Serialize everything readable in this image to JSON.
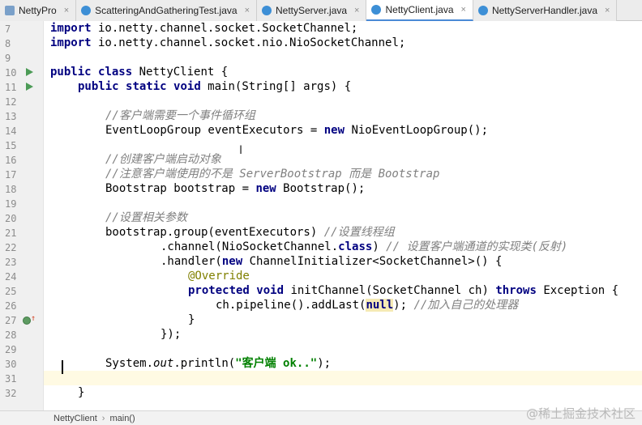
{
  "tabs": [
    {
      "label": "NettyPro",
      "icon": "module-icon",
      "color": "#7aa0c9",
      "active": false
    },
    {
      "label": "ScatteringAndGatheringTest.java",
      "icon": "class-icon",
      "color": "#3d8fd6",
      "active": false
    },
    {
      "label": "NettyServer.java",
      "icon": "class-icon",
      "color": "#3d8fd6",
      "active": false
    },
    {
      "label": "NettyClient.java",
      "icon": "class-icon",
      "color": "#3d8fd6",
      "active": true
    },
    {
      "label": "NettyServerHandler.java",
      "icon": "class-icon",
      "color": "#3d8fd6",
      "active": false
    }
  ],
  "close_glyph": "×",
  "line_numbers": [
    "7",
    "8",
    "9",
    "10",
    "11",
    "12",
    "13",
    "14",
    "15",
    "16",
    "17",
    "18",
    "19",
    "20",
    "21",
    "22",
    "23",
    "24",
    "25",
    "26",
    "27",
    "28",
    "29",
    "30",
    "31",
    "32"
  ],
  "code": {
    "l7": {
      "kw": "import",
      "rest": " io.netty.channel.socket.SocketChannel;"
    },
    "l8": {
      "kw": "import",
      "rest": " io.netty.channel.socket.nio.NioSocketChannel;"
    },
    "l10": {
      "kw1": "public",
      "kw2": "class",
      "rest": " NettyClient {"
    },
    "l11": {
      "kw1": "public",
      "kw2": "static",
      "kw3": "void",
      "rest": " main(String[] args) {"
    },
    "l13": {
      "comment": "//客户端需要一个事件循环组"
    },
    "l14": {
      "pre": "EventLoopGroup eventExecutors = ",
      "kw": "new",
      "rest": " NioEventLoopGroup();"
    },
    "l16": {
      "comment": "//创建客户端启动对象"
    },
    "l17": {
      "comment": "//注意客户端使用的不是 ServerBootstrap 而是 Bootstrap"
    },
    "l18": {
      "pre": "Bootstrap bootstrap = ",
      "kw": "new",
      "rest": " Bootstrap();"
    },
    "l20": {
      "comment": "//设置相关参数"
    },
    "l21": {
      "pre": "bootstrap.group(eventExecutors) ",
      "comment": "//设置线程组"
    },
    "l22": {
      "pre": ".channel(NioSocketChannel.",
      "kw": "class",
      "rest": ") ",
      "comment": "// 设置客户端通道的实现类(反射)"
    },
    "l23": {
      "pre": ".handler(",
      "kw": "new",
      "rest": " ChannelInitializer<SocketChannel>() {"
    },
    "l24": {
      "annotation": "@Override"
    },
    "l25": {
      "kw1": "protected",
      "kw2": "void",
      "mid": " initChannel(SocketChannel ch) ",
      "kw3": "throws",
      "rest": " Exception {"
    },
    "l26": {
      "pre": "ch.pipeline().addLast(",
      "kw": "null",
      "rest": "); ",
      "comment": "//加入自己的处理器"
    },
    "l27": {
      "text": "}"
    },
    "l28": {
      "text": "});"
    },
    "l30": {
      "pre": "System.",
      "italic": "out",
      "mid": ".println(",
      "string": "\"客户端 ok..\"",
      "rest": ");"
    },
    "l32": {
      "text": "}"
    }
  },
  "breadcrumb": {
    "class": "NettyClient",
    "separator": "›",
    "method": "main()"
  },
  "watermark": "@稀土掘金技术社区"
}
